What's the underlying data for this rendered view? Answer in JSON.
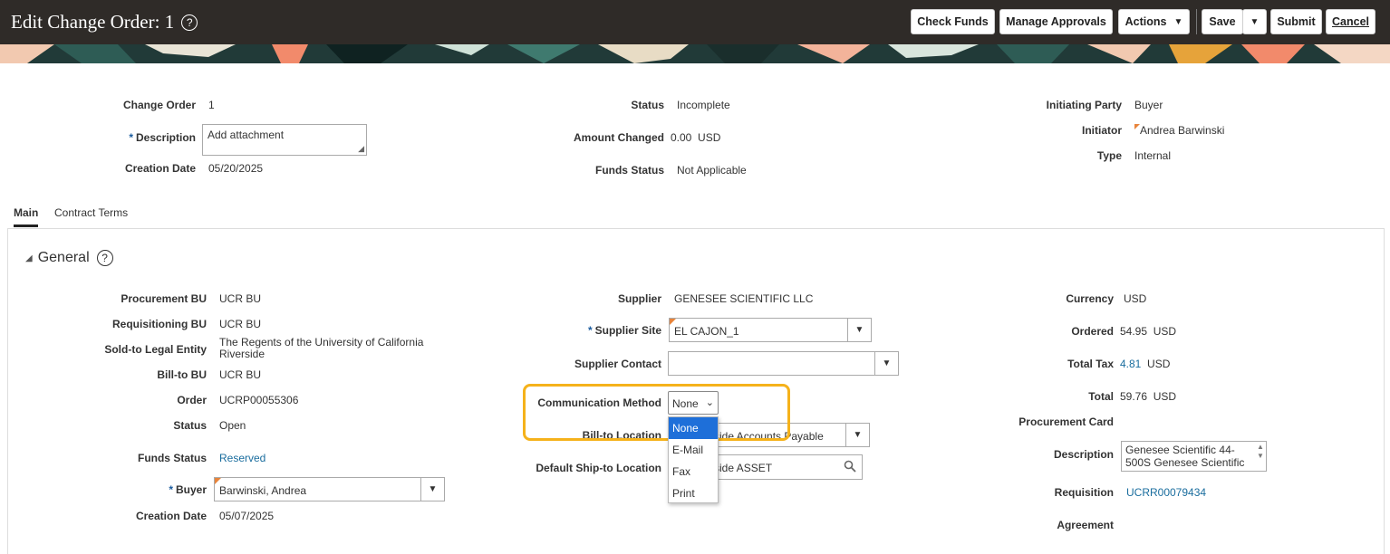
{
  "header": {
    "title": "Edit Change Order: 1",
    "buttons": {
      "check_funds": "Check Funds",
      "manage_approvals": "Manage Approvals",
      "actions": "Actions",
      "save": "Save",
      "submit": "Submit",
      "cancel": "Cancel"
    }
  },
  "summary": {
    "change_order_label": "Change Order",
    "change_order_value": "1",
    "description_label": "Description",
    "description_value": "Add attachment",
    "creation_date_label": "Creation Date",
    "creation_date_value": "05/20/2025",
    "status_label": "Status",
    "status_value": "Incomplete",
    "amount_changed_label": "Amount Changed",
    "amount_changed_value": "0.00",
    "amount_changed_currency": "USD",
    "funds_status_label": "Funds Status",
    "funds_status_value": "Not Applicable",
    "initiating_party_label": "Initiating Party",
    "initiating_party_value": "Buyer",
    "initiator_label": "Initiator",
    "initiator_value": "Andrea Barwinski",
    "type_label": "Type",
    "type_value": "Internal"
  },
  "tabs": [
    {
      "label": "Main",
      "active": true
    },
    {
      "label": "Contract Terms",
      "active": false
    }
  ],
  "general": {
    "title": "General",
    "left": {
      "procurement_bu_label": "Procurement BU",
      "procurement_bu_value": "UCR BU",
      "requisitioning_bu_label": "Requisitioning BU",
      "requisitioning_bu_value": "UCR BU",
      "sold_to_label": "Sold-to Legal Entity",
      "sold_to_line1": "The Regents of the University of California",
      "sold_to_line2": "Riverside",
      "bill_to_bu_label": "Bill-to BU",
      "bill_to_bu_value": "UCR BU",
      "order_label": "Order",
      "order_value": "UCRP00055306",
      "status_label": "Status",
      "status_value": "Open",
      "funds_status_label": "Funds Status",
      "funds_status_value": "Reserved",
      "buyer_label": "Buyer",
      "buyer_value": "Barwinski, Andrea",
      "creation_date_label": "Creation Date",
      "creation_date_value": "05/07/2025"
    },
    "middle": {
      "supplier_label": "Supplier",
      "supplier_value": "GENESEE SCIENTIFIC LLC",
      "supplier_site_label": "Supplier Site",
      "supplier_site_value": "EL CAJON_1",
      "supplier_contact_label": "Supplier Contact",
      "supplier_contact_value": "",
      "comm_method_label": "Communication Method",
      "comm_method_value": "None",
      "comm_method_options": [
        "None",
        "E-Mail",
        "Fax",
        "Print"
      ],
      "bill_to_location_label": "Bill-to Location",
      "bill_to_location_value": "side Accounts Payable",
      "ship_to_label": "Default Ship-to Location",
      "ship_to_value": "side ASSET"
    },
    "right": {
      "currency_label": "Currency",
      "currency_value": "USD",
      "ordered_label": "Ordered",
      "ordered_value": "54.95",
      "ordered_currency": "USD",
      "total_tax_label": "Total Tax",
      "total_tax_value": "4.81",
      "total_tax_currency": "USD",
      "total_label": "Total",
      "total_value": "59.76",
      "total_currency": "USD",
      "procurement_card_label": "Procurement Card",
      "description_label": "Description",
      "description_line1": "Genesee Scientific 44-",
      "description_line2": "500S Genesee Scientific",
      "requisition_label": "Requisition",
      "requisition_value": "UCRR00079434",
      "agreement_label": "Agreement"
    }
  },
  "colors": {
    "header_bg": "#2f2b28",
    "link": "#1a6d9e",
    "highlight": "#f5b21b",
    "selected": "#1e6fd9"
  }
}
